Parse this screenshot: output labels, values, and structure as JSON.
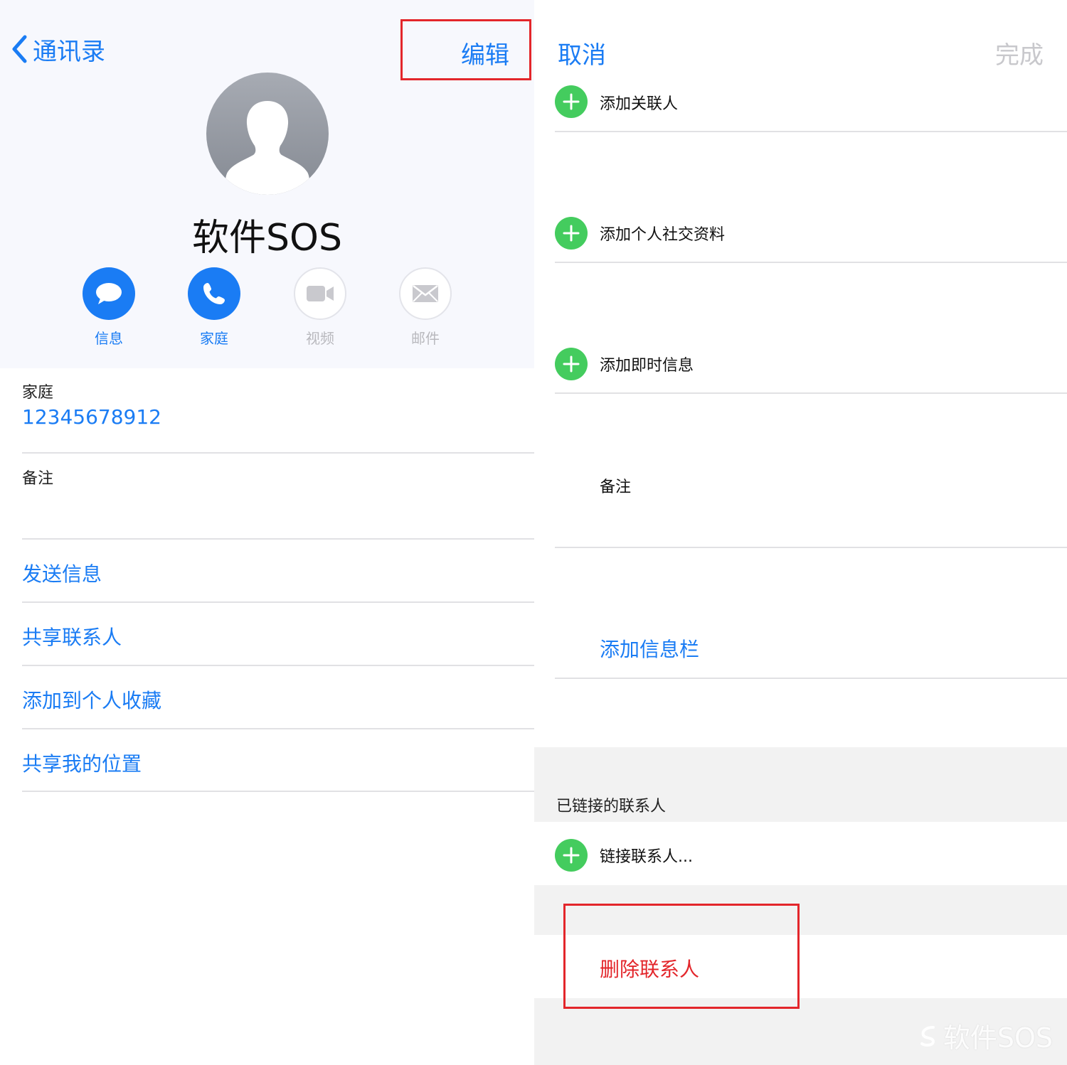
{
  "left": {
    "nav": {
      "back_label": "通讯录",
      "edit_label": "编辑"
    },
    "contact_name": "软件SOS",
    "actions": [
      {
        "label": "信息",
        "icon": "message-icon",
        "enabled": true
      },
      {
        "label": "家庭",
        "icon": "phone-icon",
        "enabled": true
      },
      {
        "label": "视频",
        "icon": "video-icon",
        "enabled": false
      },
      {
        "label": "邮件",
        "icon": "mail-icon",
        "enabled": false
      }
    ],
    "phone": {
      "label": "家庭",
      "number": "12345678912"
    },
    "notes_label": "备注",
    "links": [
      "发送信息",
      "共享联系人",
      "添加到个人收藏",
      "共享我的位置"
    ]
  },
  "right": {
    "nav": {
      "cancel_label": "取消",
      "done_label": "完成"
    },
    "add_rows": [
      "添加关联人",
      "添加个人社交资料",
      "添加即时信息"
    ],
    "notes_label": "备注",
    "add_field_label": "添加信息栏",
    "linked_header": "已链接的联系人",
    "link_contact_label": "链接联系人...",
    "delete_label": "删除联系人"
  },
  "watermark": "软件SOS",
  "colors": {
    "accent": "#1a7cf4",
    "add_green": "#44cc5e",
    "destructive": "#e3262b",
    "highlight_box": "#e3262b"
  }
}
